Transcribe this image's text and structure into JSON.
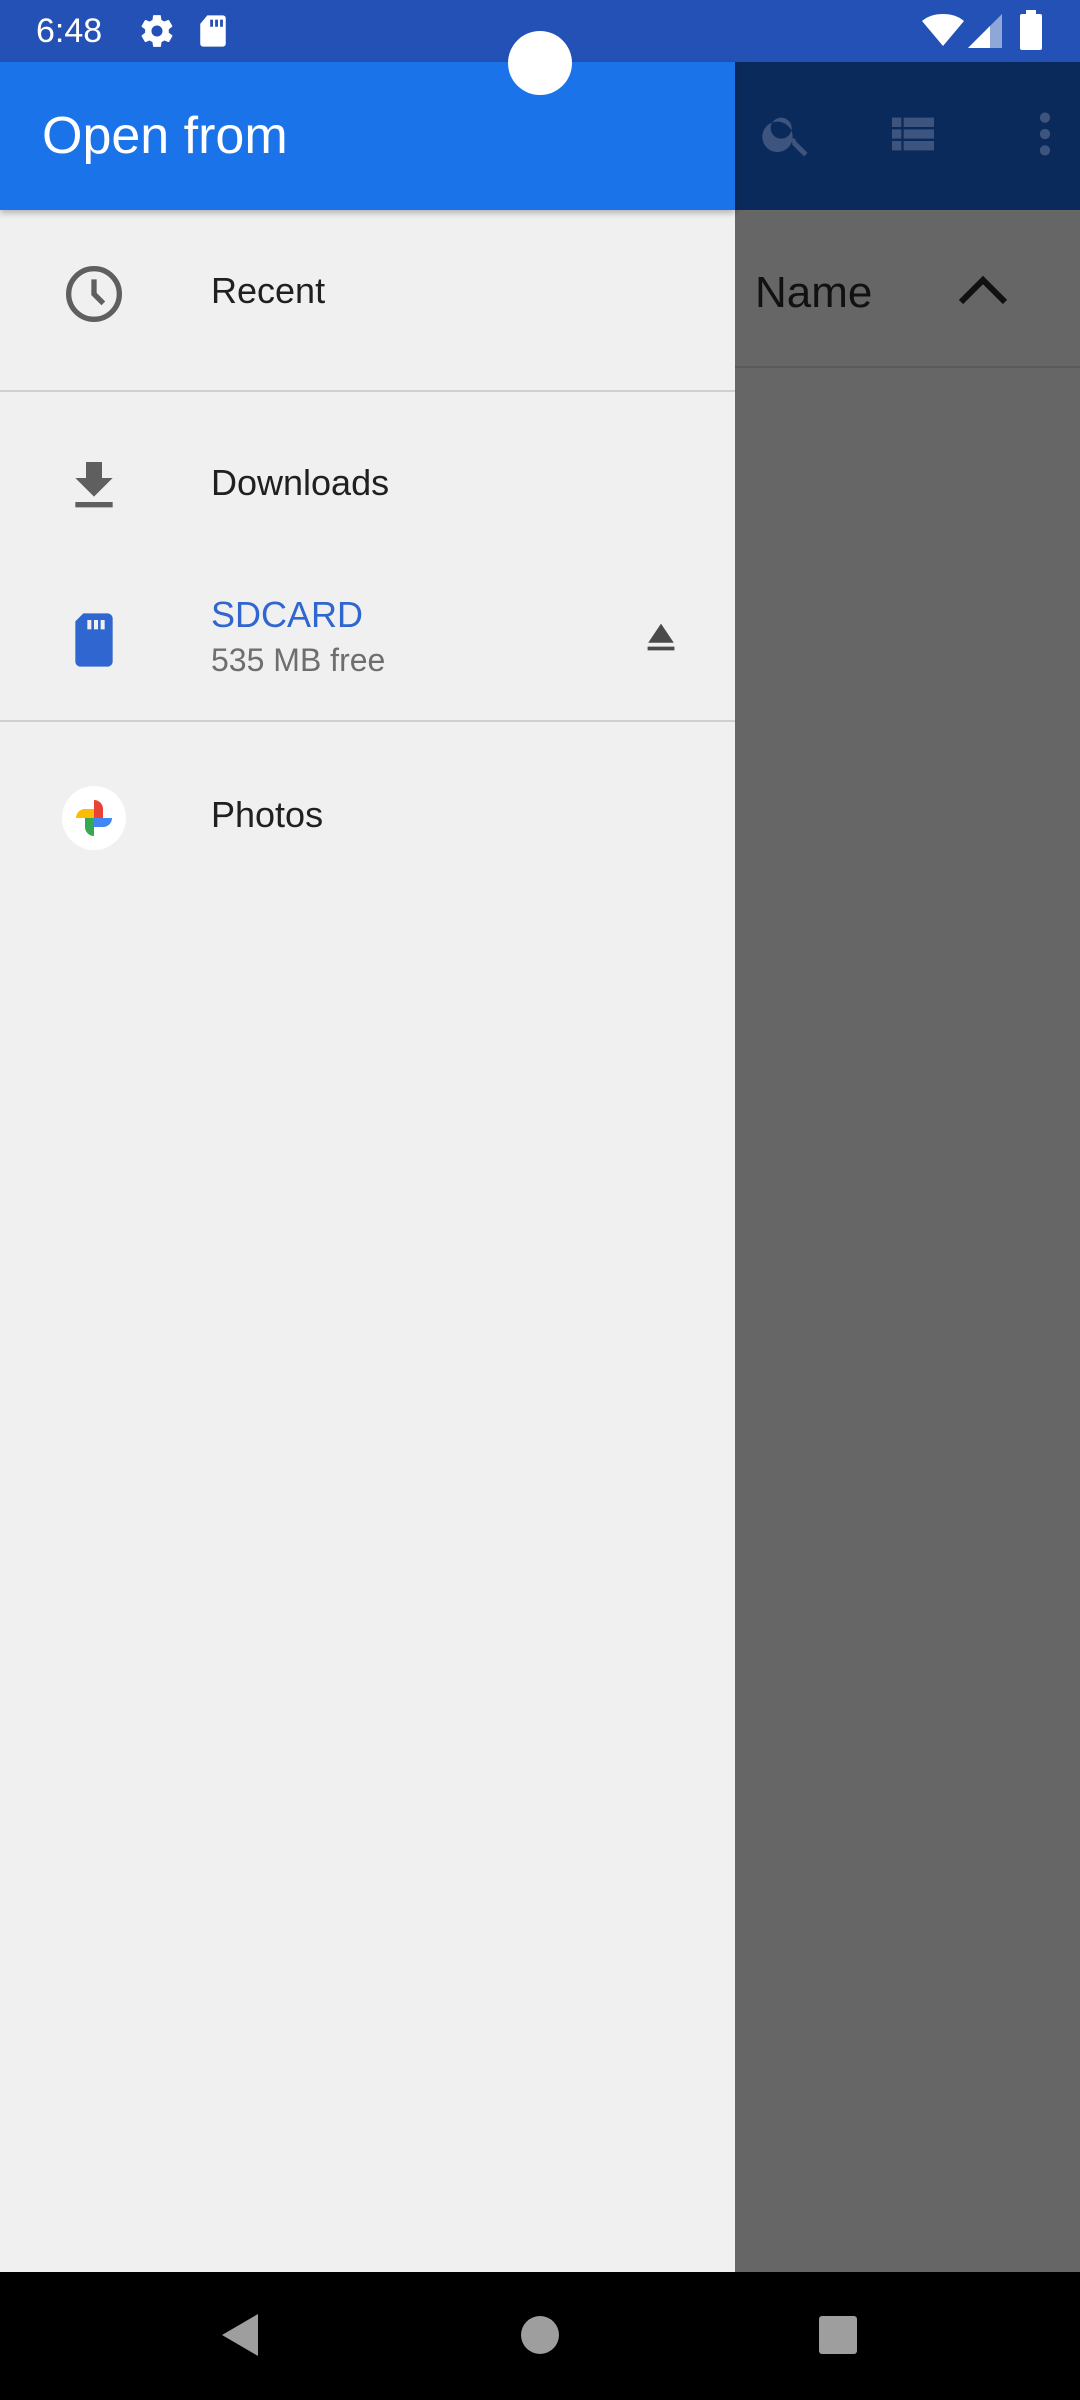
{
  "status_bar": {
    "time": "6:48",
    "icons": [
      "settings-icon",
      "sd-card-icon",
      "wifi-icon",
      "signal-icon",
      "battery-icon"
    ],
    "color": "#2451b5"
  },
  "drawer": {
    "title": "Open from",
    "header_color": "#1a73e8",
    "items": [
      {
        "label": "Recent",
        "icon": "clock-icon"
      },
      {
        "label": "Downloads",
        "icon": "download-icon"
      },
      {
        "label": "SDCARD",
        "sublabel": "535 MB free",
        "icon": "sd-card-icon",
        "action_icon": "eject-icon",
        "label_color": "#2f66d0"
      },
      {
        "label": "Photos",
        "icon": "google-photos-icon"
      }
    ]
  },
  "background_app": {
    "toolbar_icons": [
      "search-icon",
      "list-view-icon",
      "more-vert-icon"
    ],
    "sort_label": "Name",
    "sort_icon": "chevron-up-icon"
  },
  "nav_bar": {
    "buttons": [
      "back-icon",
      "home-icon",
      "recents-icon"
    ]
  }
}
